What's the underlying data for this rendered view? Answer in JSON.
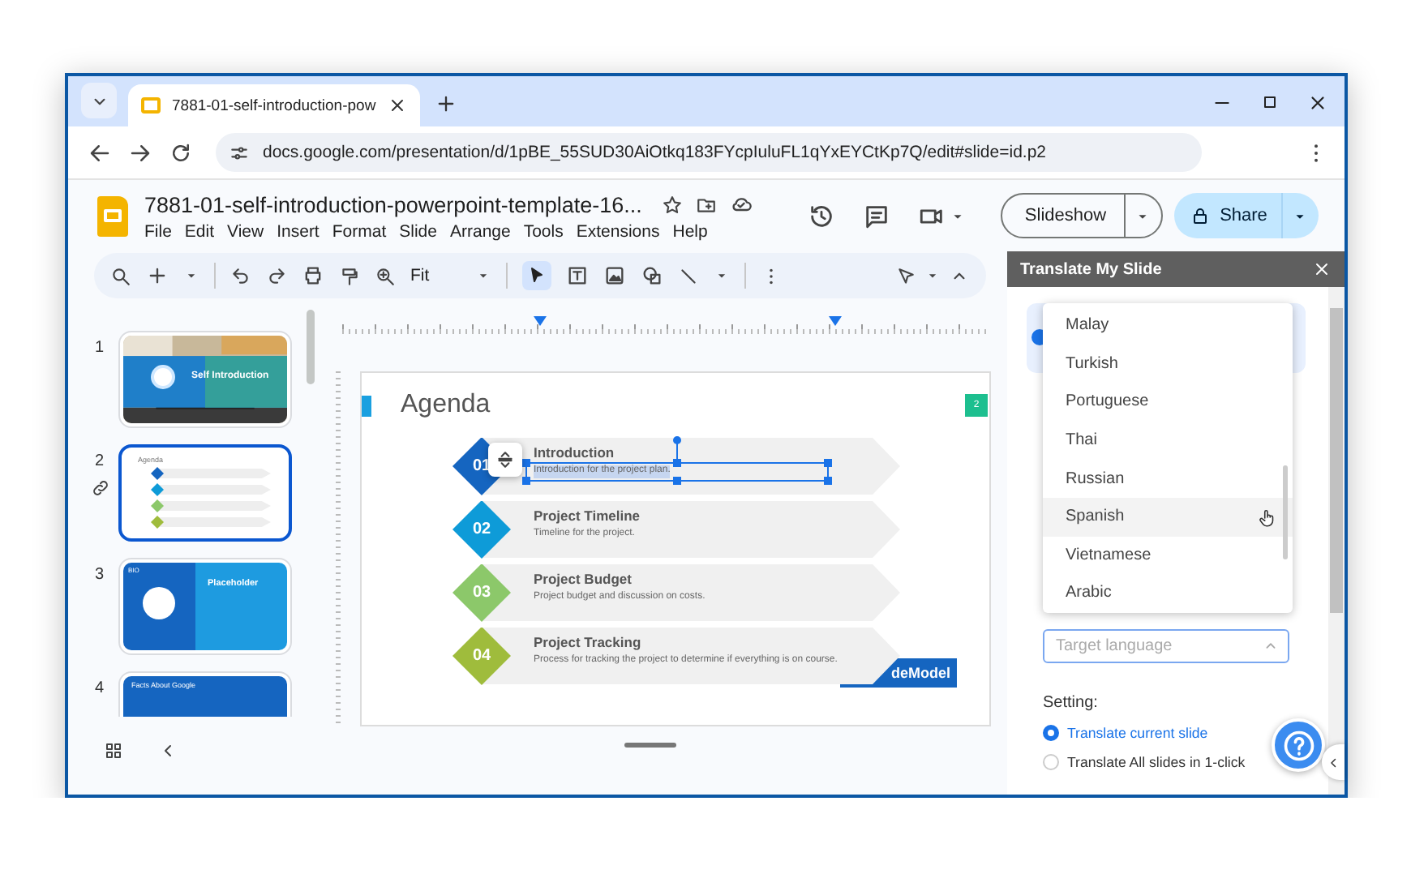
{
  "browser": {
    "tab_title": "7881-01-self-introduction-pow",
    "url": "docs.google.com/presentation/d/1pBE_55SUD30AiOtkq183FYcpIuluFL1qYxEYCtKp7Q/edit#slide=id.p2"
  },
  "document": {
    "title": "7881-01-self-introduction-powerpoint-template-16...",
    "menu": [
      "File",
      "Edit",
      "View",
      "Insert",
      "Format",
      "Slide",
      "Arrange",
      "Tools",
      "Extensions",
      "Help"
    ],
    "slideshow_label": "Slideshow",
    "share_label": "Share"
  },
  "toolbar": {
    "zoom": "Fit"
  },
  "filmstrip": [
    {
      "number": "1",
      "kind": "title",
      "selected": false,
      "title": "Self Introduction"
    },
    {
      "number": "2",
      "kind": "agenda",
      "selected": true,
      "title": "Agenda"
    },
    {
      "number": "3",
      "kind": "bio",
      "selected": false,
      "label": "BIO",
      "title": "Placeholder"
    },
    {
      "number": "4",
      "kind": "section",
      "selected": false,
      "title": "Facts About Google"
    }
  ],
  "slide": {
    "title": "Agenda",
    "page_number": "2",
    "logo_text": "deModel",
    "items": [
      {
        "number": "01",
        "title": "Introduction",
        "description": "Introduction for the project plan.",
        "color": "#1565c0",
        "selected": true
      },
      {
        "number": "02",
        "title": "Project Timeline",
        "description": "Timeline for the project.",
        "color": "#0e9bd8",
        "selected": false
      },
      {
        "number": "03",
        "title": "Project Budget",
        "description": "Project budget and discussion on costs.",
        "color": "#8cc86a",
        "selected": false
      },
      {
        "number": "04",
        "title": "Project Tracking",
        "description": "Process for tracking the project to determine if everything is on course.",
        "color": "#9fbc3c",
        "selected": false
      }
    ]
  },
  "side_panel": {
    "title": "Translate My Slide",
    "language_options": [
      {
        "label": "Malay",
        "highlighted": false
      },
      {
        "label": "Turkish",
        "highlighted": false
      },
      {
        "label": "Portuguese",
        "highlighted": false
      },
      {
        "label": "Thai",
        "highlighted": false
      },
      {
        "label": "Russian",
        "highlighted": false
      },
      {
        "label": "Spanish",
        "highlighted": true
      },
      {
        "label": "Vietnamese",
        "highlighted": false
      },
      {
        "label": "Arabic",
        "highlighted": false
      }
    ],
    "target_language": {
      "placeholder": "Target language"
    },
    "setting_label": "Setting:",
    "settings": [
      {
        "label": "Translate current slide",
        "selected": true
      },
      {
        "label": "Translate All slides in 1-click",
        "selected": false
      }
    ]
  }
}
